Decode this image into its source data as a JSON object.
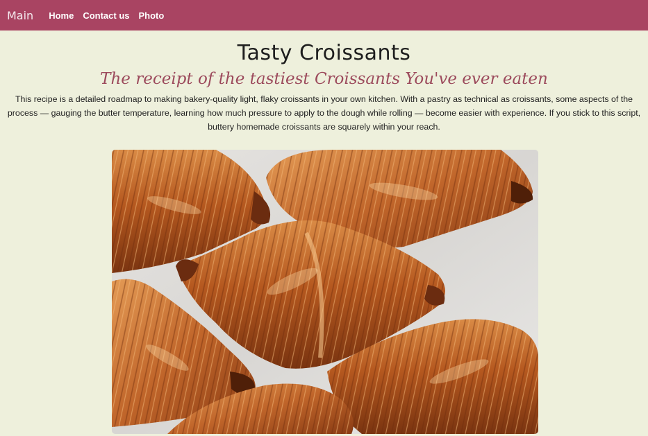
{
  "nav": {
    "brand": "Main",
    "links": [
      "Home",
      "Contact us",
      "Photo"
    ]
  },
  "header": {
    "title": "Tasty Croissants",
    "subtitle": "The receipt of the tastiest Croissants You've ever eaten"
  },
  "intro": {
    "text": "This recipe is a detailed roadmap to making bakery-quality light, flaky croissants in your own kitchen. With a pastry as technical as croissants, some aspects of the process — gauging the butter temperature, learning how much pressure to apply to the dough while rolling — become easier with experience. If you stick to this script, buttery homemade croissants are squarely within your reach."
  },
  "colors": {
    "navbar": "#a94462",
    "background": "#eef0dc",
    "subtitle": "#9c4a5c"
  }
}
